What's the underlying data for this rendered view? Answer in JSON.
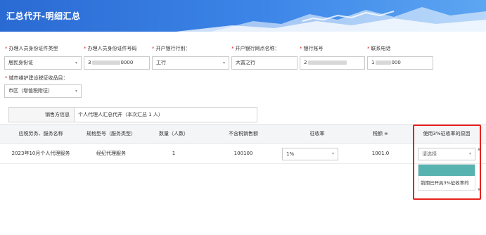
{
  "header": {
    "title": "汇总代开-明细汇总"
  },
  "form": {
    "fields": [
      {
        "label": "办理人员身份证件类型",
        "value": "居民身份证",
        "type": "select"
      },
      {
        "label": "办理人员身份证件号码",
        "value": "3",
        "masked_suffix": "0000",
        "type": "input"
      },
      {
        "label": "开户银行行别：",
        "value": "工行",
        "type": "select"
      },
      {
        "label": "开户银行网点名称：",
        "value": "大富之行",
        "type": "input"
      },
      {
        "label": "银行账号",
        "value": "2",
        "type": "input"
      },
      {
        "label": "联系电话",
        "value": "1",
        "masked_suffix": "000",
        "type": "input"
      }
    ],
    "city_tax": {
      "label": "城市维护建设税征收品目：",
      "value": "市区（增值税附征）"
    }
  },
  "seller": {
    "key": "销售方信息",
    "value": "个人代理人汇总代开（本次汇总 1 人）"
  },
  "table": {
    "headers": [
      "应税劳务、服务名称",
      "规格型号（服务类型）",
      "数量（人数）",
      "不含税销售额",
      "征收率",
      "税额 ≑",
      "使用3%征收率的原因"
    ],
    "row": {
      "service": "2023年10月个人代理服务",
      "spec": "经纪代理服务",
      "count": "1",
      "amount": "100100",
      "rate": "1%",
      "tax": "1001.0",
      "reason_placeholder": "请选择"
    }
  },
  "dropdown": {
    "option_2": "前期已开具3%征收率的"
  },
  "icons": {
    "caret": "▾",
    "required": "*"
  },
  "colors": {
    "header": "#2f74de",
    "accent": "#57b3b0",
    "highlight": "#e8211b",
    "required": "#e02020"
  }
}
